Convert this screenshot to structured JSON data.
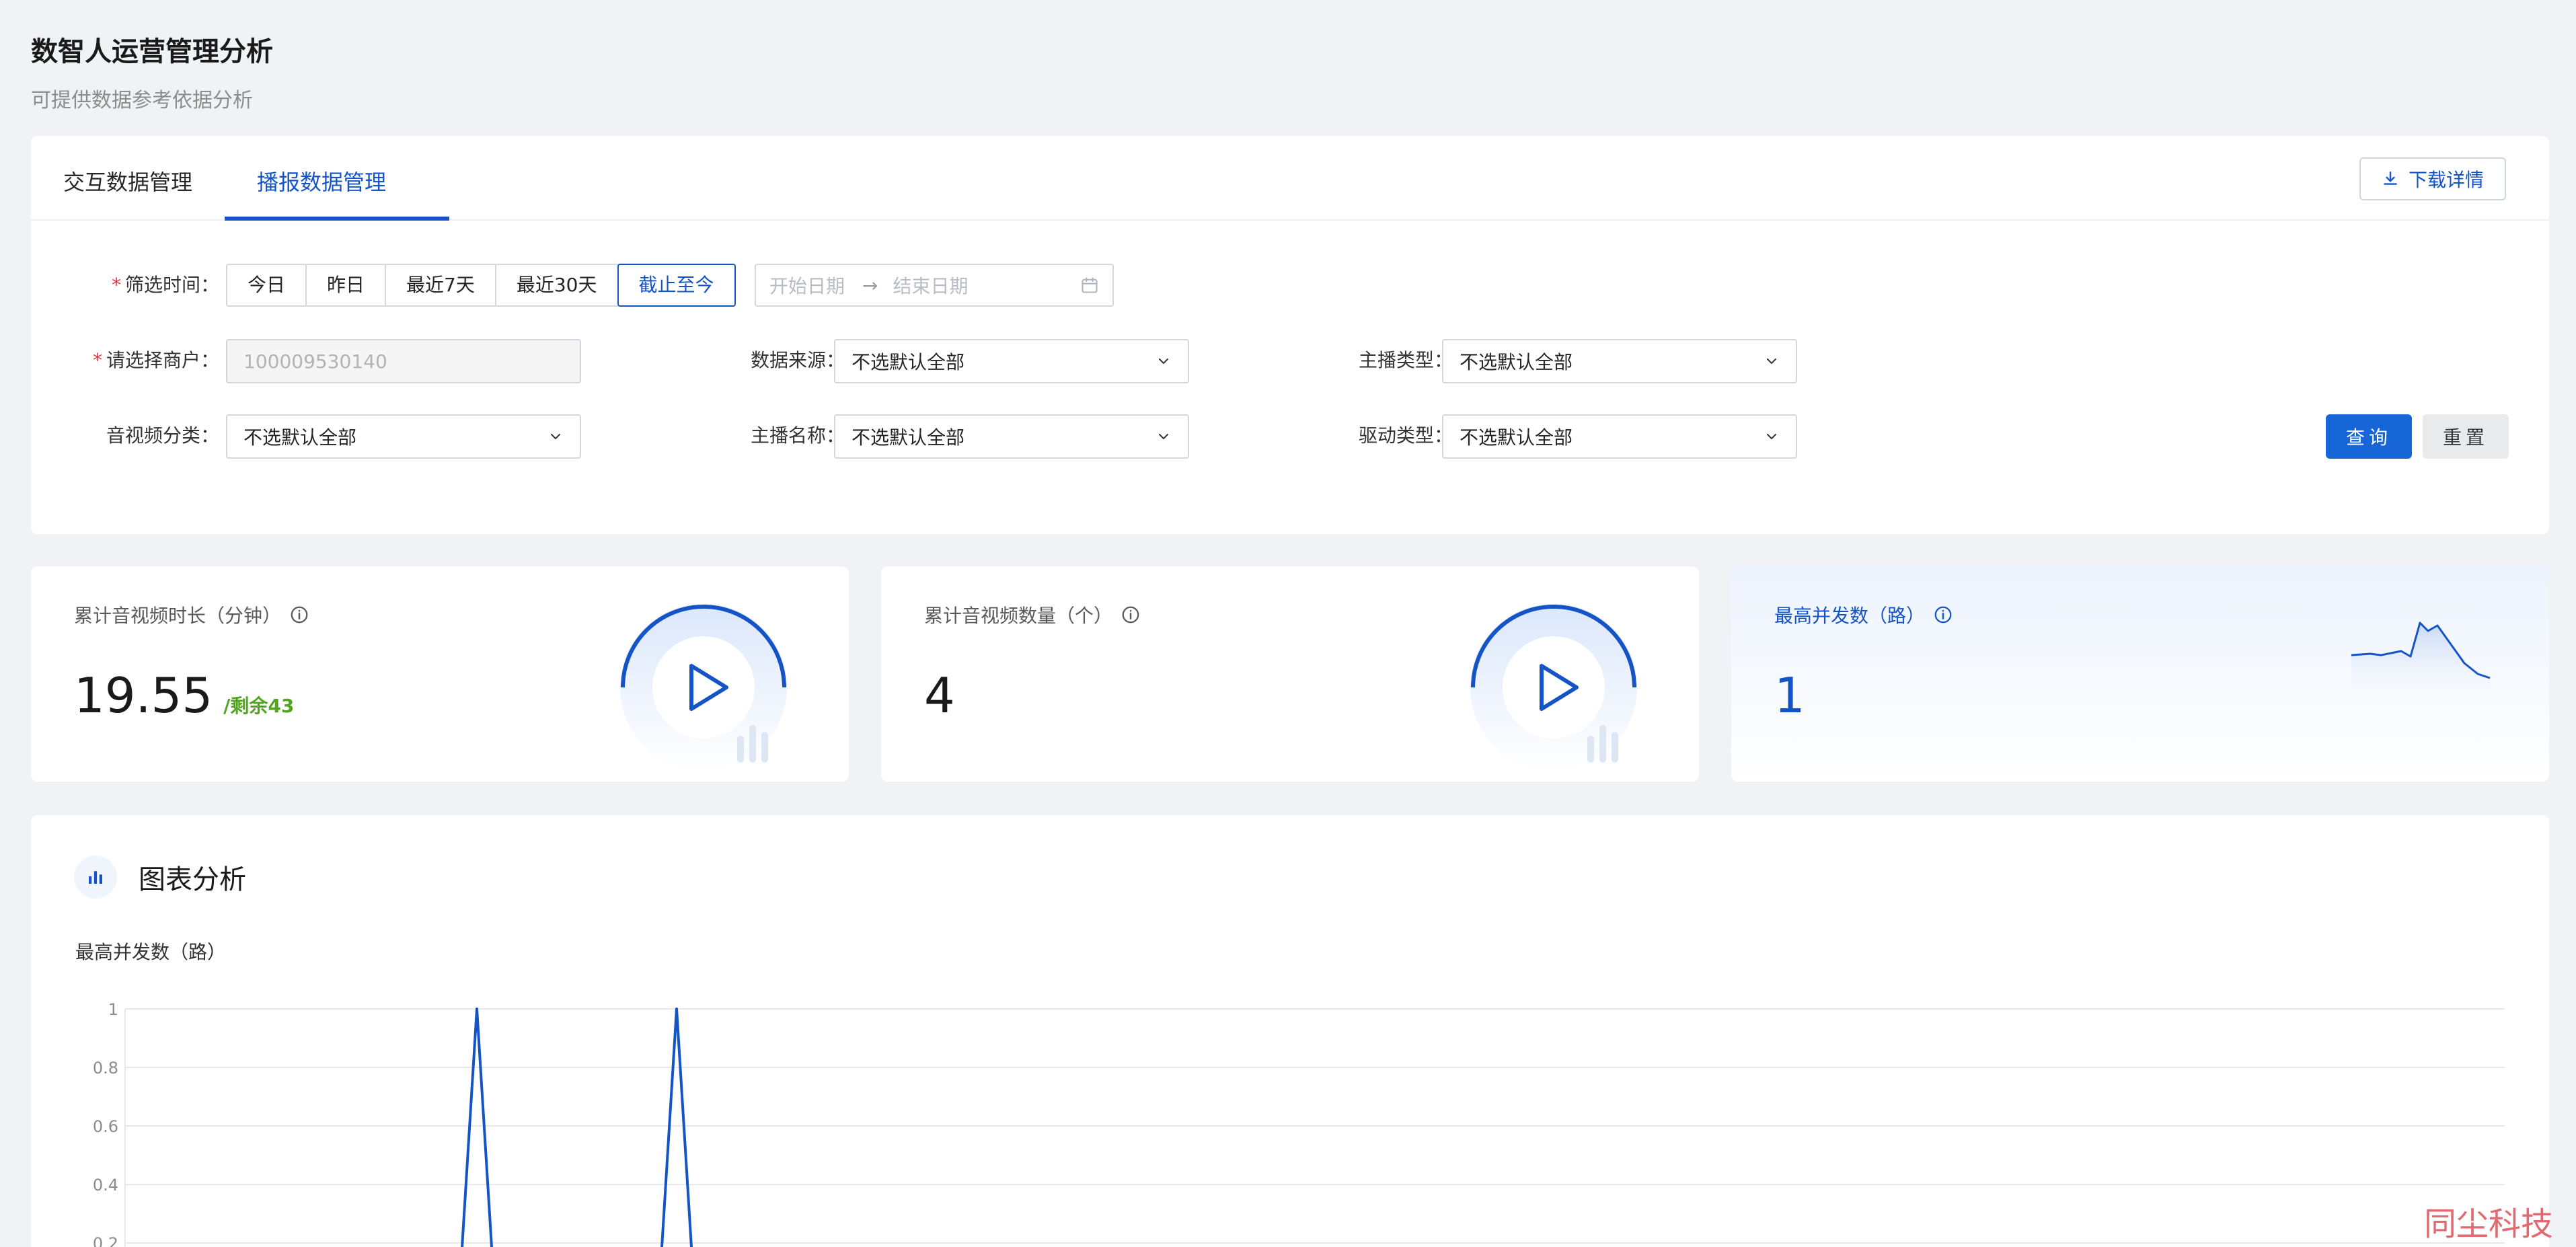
{
  "header": {
    "title": "数智人运营管理分析",
    "subtitle": "可提供数据参考依据分析"
  },
  "tabs": [
    {
      "label": "交互数据管理",
      "active": false
    },
    {
      "label": "播报数据管理",
      "active": true
    }
  ],
  "toolbar": {
    "download_label": "下载详情",
    "download_icon": "download-icon"
  },
  "filters": {
    "time": {
      "label": "筛选时间：",
      "required": true,
      "options": [
        "今日",
        "昨日",
        "最近7天",
        "最近30天",
        "截止至今"
      ],
      "selected": "截止至今",
      "start_placeholder": "开始日期",
      "end_placeholder": "结束日期"
    },
    "merchant": {
      "label": "请选择商户：",
      "required": true,
      "value": "100009530140"
    },
    "source": {
      "label": "数据来源：",
      "value": "不选默认全部"
    },
    "anchor_type": {
      "label": "主播类型：",
      "value": "不选默认全部"
    },
    "av_category": {
      "label": "音视频分类：",
      "value": "不选默认全部"
    },
    "anchor_name": {
      "label": "主播名称：",
      "value": "不选默认全部"
    },
    "drive_type": {
      "label": "驱动类型：",
      "value": "不选默认全部"
    }
  },
  "actions": {
    "query_label": "查询",
    "reset_label": "重置"
  },
  "stats": [
    {
      "label": "累计音视频时长（分钟）",
      "value": "19.55",
      "sub": "/剩余43",
      "icon": "info-icon",
      "decoration": "play-icon"
    },
    {
      "label": "累计音视频数量（个）",
      "value": "4",
      "sub": "",
      "icon": "info-icon",
      "decoration": "play-icon"
    },
    {
      "label": "最高并发数（路）",
      "value": "1",
      "sub": "",
      "icon": "info-icon",
      "decoration": "sparkline"
    }
  ],
  "chart_section": {
    "title": "图表分析",
    "icon": "bar-chart-icon"
  },
  "colors": {
    "primary": "#1554c6",
    "button_primary": "#1666d8",
    "required": "#e0343b",
    "remaining": "#52a51f",
    "background": "#f0f2f5"
  },
  "watermark": "同尘科技",
  "chart_data": {
    "type": "line",
    "title": "最高并发数（路）",
    "xlabel": "",
    "ylabel": "",
    "y_ticks": [
      "1",
      "0.8",
      "0.6",
      "0.4",
      "0.2"
    ],
    "ylim": [
      0,
      1
    ],
    "grid": true,
    "series": [
      {
        "values": [
          0,
          0,
          0,
          0,
          0,
          0,
          0,
          0,
          0,
          0,
          0,
          0,
          0,
          0,
          0,
          0,
          0,
          0,
          0,
          1,
          0,
          0,
          0,
          0,
          0,
          0,
          0,
          0,
          0,
          0,
          1,
          0,
          0,
          0,
          0,
          0,
          0,
          0,
          0,
          0,
          0,
          0,
          0,
          0,
          0,
          0,
          0,
          0,
          0,
          0,
          0,
          0,
          0,
          0,
          0,
          0,
          0,
          0,
          0,
          0,
          0,
          0,
          0,
          0,
          0,
          0,
          0,
          0,
          0,
          0
        ]
      }
    ]
  }
}
